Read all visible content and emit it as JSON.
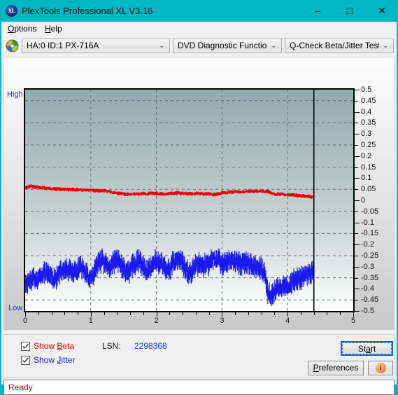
{
  "window": {
    "title": "PlexTools Professional XL V3.16",
    "icon": "xl-app-icon",
    "icon_text": "XL",
    "accent": "#00b7c3",
    "controls": {
      "minimize": "–",
      "maximize": "□",
      "close": "✕"
    }
  },
  "menubar": {
    "items": [
      {
        "label": "Options",
        "accel": "O"
      },
      {
        "label": "Help",
        "accel": "H"
      }
    ]
  },
  "toolbar": {
    "drive_icon": "optical-disc-icon",
    "drive_select": {
      "value": "HA:0 ID:1  PX-716A",
      "caret": "⌄"
    },
    "function_select": {
      "value": "DVD Diagnostic Functions",
      "caret": "⌄"
    },
    "test_select": {
      "value": "Q-Check Beta/Jitter Test",
      "caret": "⌄"
    }
  },
  "chart_labels": {
    "high": "High",
    "low": "Low"
  },
  "controls": {
    "show_beta": {
      "label_prefix": "Show ",
      "label_accel": "B",
      "label_suffix": "eta",
      "checked": true,
      "color": "#ee0000"
    },
    "show_jitter": {
      "label_prefix": "Show ",
      "label_accel": "J",
      "label_suffix": "itter",
      "checked": true,
      "color": "#1a1aee"
    },
    "lsn_label": "LSN:",
    "lsn_value": "2298368",
    "start_button": {
      "prefix": "St",
      "accel": "a",
      "suffix": "rt"
    },
    "preferences_button": {
      "prefix": "",
      "accel": "P",
      "suffix": "references"
    },
    "info_button": {
      "glyph": "i",
      "name": "info-icon"
    }
  },
  "statusbar": {
    "text": "Ready",
    "color": "#e00000"
  },
  "chart_data": {
    "type": "line",
    "title": "Q-Check Beta/Jitter Test",
    "xlabel": "",
    "ylabel": "",
    "xlim": [
      0,
      5
    ],
    "ylim": [
      -0.5,
      0.5
    ],
    "xticks": [
      0,
      1,
      2,
      3,
      4,
      5
    ],
    "yticks": [
      0.5,
      0.45,
      0.4,
      0.35,
      0.3,
      0.25,
      0.2,
      0.15,
      0.1,
      0.05,
      0,
      -0.05,
      -0.1,
      -0.15,
      -0.2,
      -0.25,
      -0.3,
      -0.35,
      -0.4,
      -0.45,
      -0.5
    ],
    "ytick_labels": [
      "0.5",
      "0.45",
      "0.4",
      "0.35",
      "0.3",
      "0.25",
      "0.2",
      "0.15",
      "0.1",
      "0.05",
      "0",
      "-0.05",
      "-0.1",
      "-0.15",
      "-0.2",
      "-0.25",
      "-0.3",
      "-0.35",
      "-0.4",
      "-0.45",
      "-0.5"
    ],
    "xtick_labels": [
      "0",
      "1",
      "2",
      "3",
      "4",
      "5"
    ],
    "grid": true,
    "grid_style": "dashed",
    "grid_y_values": [
      0.45,
      0.35,
      0.25,
      0.15,
      0.05,
      -0.05,
      -0.15,
      -0.25,
      -0.35,
      -0.45
    ],
    "grid_x_values": [
      1,
      2,
      3,
      4
    ],
    "axis_left_label": "High",
    "axis_left_label_bottom": "Low",
    "data_end_marker_x": 4.4,
    "legend": [
      "Show Beta",
      "Show Jitter"
    ],
    "series": [
      {
        "name": "Beta",
        "color": "#ee0000",
        "x_start": 0.0,
        "x_end": 4.4,
        "noise": 0.006,
        "control_points": [
          [
            0.0,
            0.055
          ],
          [
            0.05,
            0.062
          ],
          [
            0.1,
            0.063
          ],
          [
            0.15,
            0.06
          ],
          [
            0.2,
            0.058
          ],
          [
            0.3,
            0.055
          ],
          [
            0.4,
            0.052
          ],
          [
            0.5,
            0.05
          ],
          [
            0.6,
            0.049
          ],
          [
            0.7,
            0.048
          ],
          [
            0.8,
            0.047
          ],
          [
            0.9,
            0.046
          ],
          [
            1.0,
            0.045
          ],
          [
            1.1,
            0.044
          ],
          [
            1.2,
            0.042
          ],
          [
            1.3,
            0.039
          ],
          [
            1.4,
            0.033
          ],
          [
            1.5,
            0.028
          ],
          [
            1.6,
            0.027
          ],
          [
            1.7,
            0.028
          ],
          [
            1.8,
            0.03
          ],
          [
            1.9,
            0.031
          ],
          [
            2.0,
            0.031
          ],
          [
            2.1,
            0.029
          ],
          [
            2.2,
            0.032
          ],
          [
            2.3,
            0.033
          ],
          [
            2.4,
            0.031
          ],
          [
            2.5,
            0.03
          ],
          [
            2.6,
            0.031
          ],
          [
            2.7,
            0.03
          ],
          [
            2.8,
            0.028
          ],
          [
            2.9,
            0.026
          ],
          [
            3.0,
            0.034
          ],
          [
            3.1,
            0.036
          ],
          [
            3.2,
            0.038
          ],
          [
            3.3,
            0.039
          ],
          [
            3.4,
            0.041
          ],
          [
            3.5,
            0.042
          ],
          [
            3.6,
            0.04
          ],
          [
            3.7,
            0.041
          ],
          [
            3.8,
            0.028
          ],
          [
            3.9,
            0.027
          ],
          [
            4.0,
            0.026
          ],
          [
            4.1,
            0.024
          ],
          [
            4.2,
            0.021
          ],
          [
            4.3,
            0.018
          ],
          [
            4.4,
            0.016
          ]
        ]
      },
      {
        "name": "Jitter",
        "color": "#1a1aee",
        "x_start": 0.0,
        "x_end": 4.4,
        "band": true,
        "band_width": 0.055,
        "noise": 0.022,
        "control_points": [
          [
            0.0,
            -0.375
          ],
          [
            0.05,
            -0.365
          ],
          [
            0.1,
            -0.355
          ],
          [
            0.15,
            -0.35
          ],
          [
            0.2,
            -0.352
          ],
          [
            0.25,
            -0.345
          ],
          [
            0.3,
            -0.32
          ],
          [
            0.35,
            -0.33
          ],
          [
            0.4,
            -0.345
          ],
          [
            0.45,
            -0.35
          ],
          [
            0.5,
            -0.34
          ],
          [
            0.55,
            -0.325
          ],
          [
            0.6,
            -0.31
          ],
          [
            0.65,
            -0.305
          ],
          [
            0.7,
            -0.315
          ],
          [
            0.75,
            -0.325
          ],
          [
            0.8,
            -0.31
          ],
          [
            0.85,
            -0.305
          ],
          [
            0.9,
            -0.318
          ],
          [
            0.95,
            -0.335
          ],
          [
            1.0,
            -0.35
          ],
          [
            1.05,
            -0.33
          ],
          [
            1.1,
            -0.29
          ],
          [
            1.15,
            -0.275
          ],
          [
            1.2,
            -0.282
          ],
          [
            1.25,
            -0.295
          ],
          [
            1.3,
            -0.3
          ],
          [
            1.35,
            -0.282
          ],
          [
            1.4,
            -0.272
          ],
          [
            1.45,
            -0.285
          ],
          [
            1.5,
            -0.31
          ],
          [
            1.55,
            -0.33
          ],
          [
            1.6,
            -0.315
          ],
          [
            1.65,
            -0.29
          ],
          [
            1.7,
            -0.278
          ],
          [
            1.75,
            -0.28
          ],
          [
            1.8,
            -0.295
          ],
          [
            1.85,
            -0.32
          ],
          [
            1.9,
            -0.31
          ],
          [
            1.95,
            -0.285
          ],
          [
            2.0,
            -0.272
          ],
          [
            2.05,
            -0.275
          ],
          [
            2.1,
            -0.295
          ],
          [
            2.15,
            -0.32
          ],
          [
            2.2,
            -0.31
          ],
          [
            2.25,
            -0.285
          ],
          [
            2.3,
            -0.27
          ],
          [
            2.35,
            -0.268
          ],
          [
            2.4,
            -0.282
          ],
          [
            2.45,
            -0.308
          ],
          [
            2.5,
            -0.33
          ],
          [
            2.55,
            -0.318
          ],
          [
            2.6,
            -0.295
          ],
          [
            2.65,
            -0.282
          ],
          [
            2.7,
            -0.288
          ],
          [
            2.75,
            -0.3
          ],
          [
            2.8,
            -0.285
          ],
          [
            2.85,
            -0.272
          ],
          [
            2.9,
            -0.268
          ],
          [
            2.95,
            -0.275
          ],
          [
            3.0,
            -0.29
          ],
          [
            3.05,
            -0.278
          ],
          [
            3.1,
            -0.268
          ],
          [
            3.15,
            -0.272
          ],
          [
            3.2,
            -0.28
          ],
          [
            3.25,
            -0.285
          ],
          [
            3.3,
            -0.282
          ],
          [
            3.35,
            -0.28
          ],
          [
            3.4,
            -0.285
          ],
          [
            3.45,
            -0.292
          ],
          [
            3.5,
            -0.3
          ],
          [
            3.55,
            -0.305
          ],
          [
            3.6,
            -0.31
          ],
          [
            3.65,
            -0.33
          ],
          [
            3.7,
            -0.42
          ],
          [
            3.75,
            -0.43
          ],
          [
            3.8,
            -0.418
          ],
          [
            3.85,
            -0.4
          ],
          [
            3.9,
            -0.395
          ],
          [
            3.95,
            -0.392
          ],
          [
            4.0,
            -0.385
          ],
          [
            4.05,
            -0.378
          ],
          [
            4.1,
            -0.368
          ],
          [
            4.15,
            -0.362
          ],
          [
            4.2,
            -0.355
          ],
          [
            4.25,
            -0.34
          ],
          [
            4.3,
            -0.332
          ],
          [
            4.35,
            -0.33
          ],
          [
            4.4,
            -0.325
          ]
        ]
      }
    ]
  }
}
